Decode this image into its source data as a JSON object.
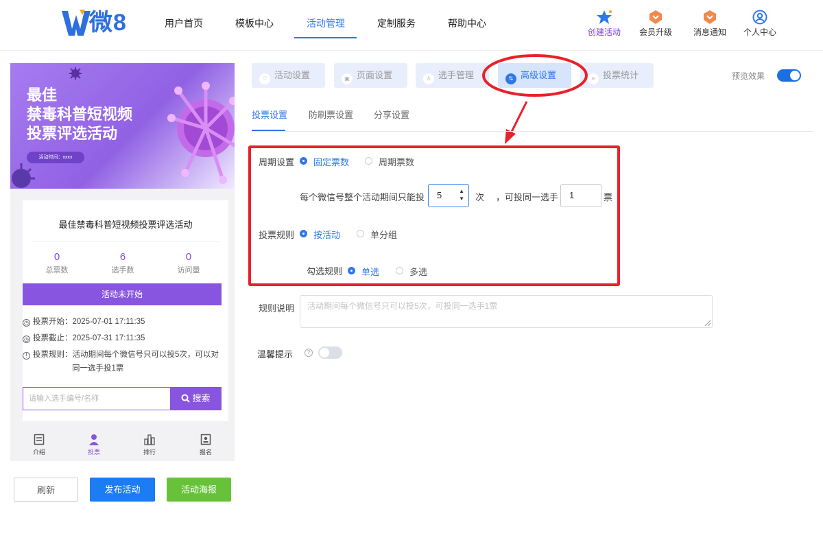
{
  "brand": {
    "logo_text": "微8"
  },
  "nav": [
    "用户首页",
    "模板中心",
    "活动管理",
    "定制服务",
    "帮助中心"
  ],
  "toolbar": {
    "create": "创建活动",
    "vip": "会员升级",
    "notify": "消息通知",
    "profile": "个人中心"
  },
  "preview": {
    "banner": {
      "line1": "最佳",
      "line2": "禁毒科普短视频",
      "line3": "投票评选活动",
      "time": "活动时间：xxxx"
    },
    "title": "最佳禁毒科普短视频投票评选活动",
    "stats": [
      {
        "value": "0",
        "label": "总票数"
      },
      {
        "value": "6",
        "label": "选手数"
      },
      {
        "value": "0",
        "label": "访问量"
      }
    ],
    "status": "活动未开始",
    "vote_start": "投票开始：2025-07-01 17:11:35",
    "vote_end": "投票截止：2025-07-31 17:11:35",
    "rule_line1": "投票规则：活动期间每个微信号只可以投5次，可以对",
    "rule_line2": "同一选手投1票",
    "search_placeholder": "请输入选手编号/名称",
    "search_button": "搜索",
    "tabbar": [
      "介绍",
      "投票",
      "排行",
      "报名"
    ]
  },
  "actions": {
    "refresh": "刷新",
    "publish": "发布活动",
    "poster": "活动海报"
  },
  "tabs": [
    "活动设置",
    "页面设置",
    "选手管理",
    "高级设置",
    "投票统计"
  ],
  "preview_toggle": {
    "label": "预览效果",
    "on": true
  },
  "subtabs": [
    "投票设置",
    "防刷票设置",
    "分享设置"
  ],
  "form": {
    "period_label": "周期设置",
    "period_options": [
      "固定票数",
      "周期票数"
    ],
    "period_text": "每个微信号整个活动期间只能投",
    "period_value": "5",
    "times_unit": "次",
    "same_player_text": "，可投同一选手",
    "same_player_value": "1",
    "votes_unit": "票",
    "rule_label": "投票规则",
    "rule_options": [
      "按活动",
      "单分组"
    ],
    "check_label": "勾选规则",
    "check_options": [
      "单选",
      "多选"
    ],
    "desc_label": "规则说明",
    "desc_placeholder": "活动期间每个微信号只可以投5次，可投同一选手1票",
    "tip_label": "温馨提示",
    "tip_help": "?",
    "tip_on": false
  },
  "colors": {
    "primary": "#2e78e8",
    "purple": "#8855e0",
    "highlight": "#e8212a",
    "green": "#67c23a"
  }
}
